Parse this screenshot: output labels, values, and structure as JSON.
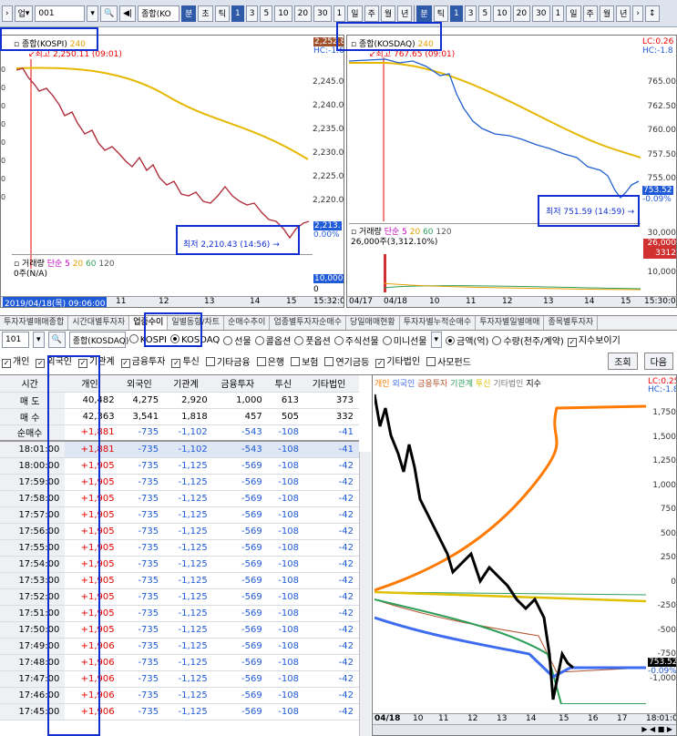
{
  "toolbar": {
    "market_label": "업",
    "code": "001",
    "name": "종합(KO",
    "minute_label": "분",
    "tick_label": "초",
    "tick": "틱",
    "sel_num": "1",
    "intervals": [
      "3",
      "5",
      "10",
      "20",
      "30"
    ],
    "num_after": "1",
    "periods": [
      "일",
      "주",
      "월",
      "년"
    ],
    "right_minute": "분",
    "right_tick": "틱",
    "right_sel": "1",
    "right_num_after": "1"
  },
  "left_chart": {
    "title": "종합(KOSPI)",
    "period": "240",
    "hi_label": "최고 2,250.11 (09:01)",
    "lo_label": "최저 2,210.43 (14:56)",
    "right_top": "2,252.8",
    "right_top2": "HC:-1.62",
    "yticks": [
      "2,245.0",
      "2,240.0",
      "2,235.0",
      "2,230.0",
      "2,225.0",
      "2,220.0",
      "2,215.0"
    ],
    "ycur": "2,213.",
    "ycur2": "0.00%",
    "xlabels": [
      "2019/04/18(목) 09:06:00",
      "11",
      "12",
      "13",
      "14",
      "15",
      "15:32:0"
    ],
    "vol_title": "거래량",
    "vol_sma": "단순",
    "vol_5": "5",
    "vol_20": "20",
    "vol_60": "60",
    "vol_120": "120",
    "vol_val": "0주(N/A)",
    "vol_axis": "10,000",
    "vol_axis2": "0",
    "left_edge_vals": [
      "0",
      "0",
      "0",
      "0",
      "0",
      "0",
      "0",
      "0"
    ]
  },
  "right_chart": {
    "title": "종합(KOSDAQ)",
    "period": "240",
    "hi_label": "최고 767.65 (09:01)",
    "lo_label": "최저 751.59 (14:59)",
    "lc": "LC:0.26",
    "hc": "HC:-1.8",
    "yticks": [
      "765.00",
      "762.50",
      "760.00",
      "757.50",
      "755.00"
    ],
    "ycur": "753.52",
    "ycur2": "-0.09%",
    "vol_title": "거래량",
    "vol_sma": "단순",
    "vol_5": "5",
    "vol_20": "20",
    "vol_60": "60",
    "vol_120": "120",
    "vol_val": "26,000주(3,312.10%)",
    "vol_axis": [
      "30,000",
      "26,000",
      "3312",
      "10,000"
    ],
    "xlabels": [
      "04/17",
      "04/18",
      "10",
      "11",
      "12",
      "13",
      "14",
      "15",
      "15:30:0"
    ]
  },
  "tabs": [
    "투자자별매매종합",
    "시간대별투자자",
    "업종수이",
    "일별동향/차트",
    "순매수추이",
    "업종별투자자순매수",
    "당일매매현황",
    "투자자별누적순매수",
    "투자자별일별매매",
    "종목별투자자"
  ],
  "controls": {
    "code": "101",
    "name": "종합(KOSDAQ)",
    "markets": [
      "KOSPI",
      "KOSDAQ",
      "선물",
      "콜옵션",
      "풋옵션",
      "주식선물",
      "미니선물"
    ],
    "units": [
      "금액(억)",
      "수량(천주/계약)"
    ],
    "show_index": "지수보이기"
  },
  "filters": [
    "개인",
    "외국인",
    "기관계",
    "금융투자",
    "투신",
    "기타금융",
    "은행",
    "보험",
    "연기금등",
    "기타법인",
    "사모펀드"
  ],
  "buttons": {
    "lookup": "조회",
    "next": "다음"
  },
  "table": {
    "headers": [
      "시간",
      "개인",
      "외국인",
      "기관계",
      "금융투자",
      "투신",
      "기타법인"
    ],
    "summary": [
      [
        "매 도",
        "40,482",
        "4,275",
        "2,920",
        "1,000",
        "613",
        "373"
      ],
      [
        "매 수",
        "42,363",
        "3,541",
        "1,818",
        "457",
        "505",
        "332"
      ],
      [
        "순매수",
        "+1,881",
        "-735",
        "-1,102",
        "-543",
        "-108",
        "-41"
      ]
    ],
    "rows": [
      [
        "18:01:00",
        "+1,881",
        "-735",
        "-1,102",
        "-543",
        "-108",
        "-41"
      ],
      [
        "18:00:00",
        "+1,905",
        "-735",
        "-1,125",
        "-569",
        "-108",
        "-42"
      ],
      [
        "17:59:00",
        "+1,905",
        "-735",
        "-1,125",
        "-569",
        "-108",
        "-42"
      ],
      [
        "17:58:00",
        "+1,905",
        "-735",
        "-1,125",
        "-569",
        "-108",
        "-42"
      ],
      [
        "17:57:00",
        "+1,905",
        "-735",
        "-1,125",
        "-569",
        "-108",
        "-42"
      ],
      [
        "17:56:00",
        "+1,905",
        "-735",
        "-1,125",
        "-569",
        "-108",
        "-42"
      ],
      [
        "17:55:00",
        "+1,905",
        "-735",
        "-1,125",
        "-569",
        "-108",
        "-42"
      ],
      [
        "17:54:00",
        "+1,905",
        "-735",
        "-1,125",
        "-569",
        "-108",
        "-42"
      ],
      [
        "17:53:00",
        "+1,905",
        "-735",
        "-1,125",
        "-569",
        "-108",
        "-42"
      ],
      [
        "17:52:00",
        "+1,905",
        "-735",
        "-1,125",
        "-569",
        "-108",
        "-42"
      ],
      [
        "17:51:00",
        "+1,905",
        "-735",
        "-1,125",
        "-569",
        "-108",
        "-42"
      ],
      [
        "17:50:00",
        "+1,905",
        "-735",
        "-1,125",
        "-569",
        "-108",
        "-42"
      ],
      [
        "17:49:00",
        "+1,906",
        "-735",
        "-1,125",
        "-569",
        "-108",
        "-42"
      ],
      [
        "17:48:00",
        "+1,906",
        "-735",
        "-1,125",
        "-569",
        "-108",
        "-42"
      ],
      [
        "17:47:00",
        "+1,906",
        "-735",
        "-1,125",
        "-569",
        "-108",
        "-42"
      ],
      [
        "17:46:00",
        "+1,906",
        "-735",
        "-1,125",
        "-569",
        "-108",
        "-42"
      ],
      [
        "17:45:00",
        "+1,906",
        "-735",
        "-1,125",
        "-569",
        "-108",
        "-42"
      ]
    ]
  },
  "legend": [
    "개인",
    "외국인",
    "금융투자",
    "기관계",
    "투신",
    "기타법인",
    "지수"
  ],
  "flow_chart": {
    "lc": "LC:0.25",
    "hc": "HC:-1.8",
    "yticks": [
      "1,750",
      "1,500",
      "1,250",
      "1,000",
      "750",
      "500",
      "250",
      "0",
      "-250",
      "-500",
      "-750",
      "-1,000"
    ],
    "ycur": "753.52",
    "ycur2": "-0.09%",
    "xlabels": [
      "04/18",
      "10",
      "11",
      "12",
      "13",
      "14",
      "15",
      "16",
      "17",
      "18:01:0"
    ]
  },
  "colors": {
    "individual": "#ff7a00",
    "foreign": "#3d6cf0",
    "inst": "#2e9e58",
    "fin": "#b5542f",
    "trust": "#e0c000",
    "other": "#9a9a9a",
    "index": "#000000",
    "highlight": "#1230d0"
  }
}
